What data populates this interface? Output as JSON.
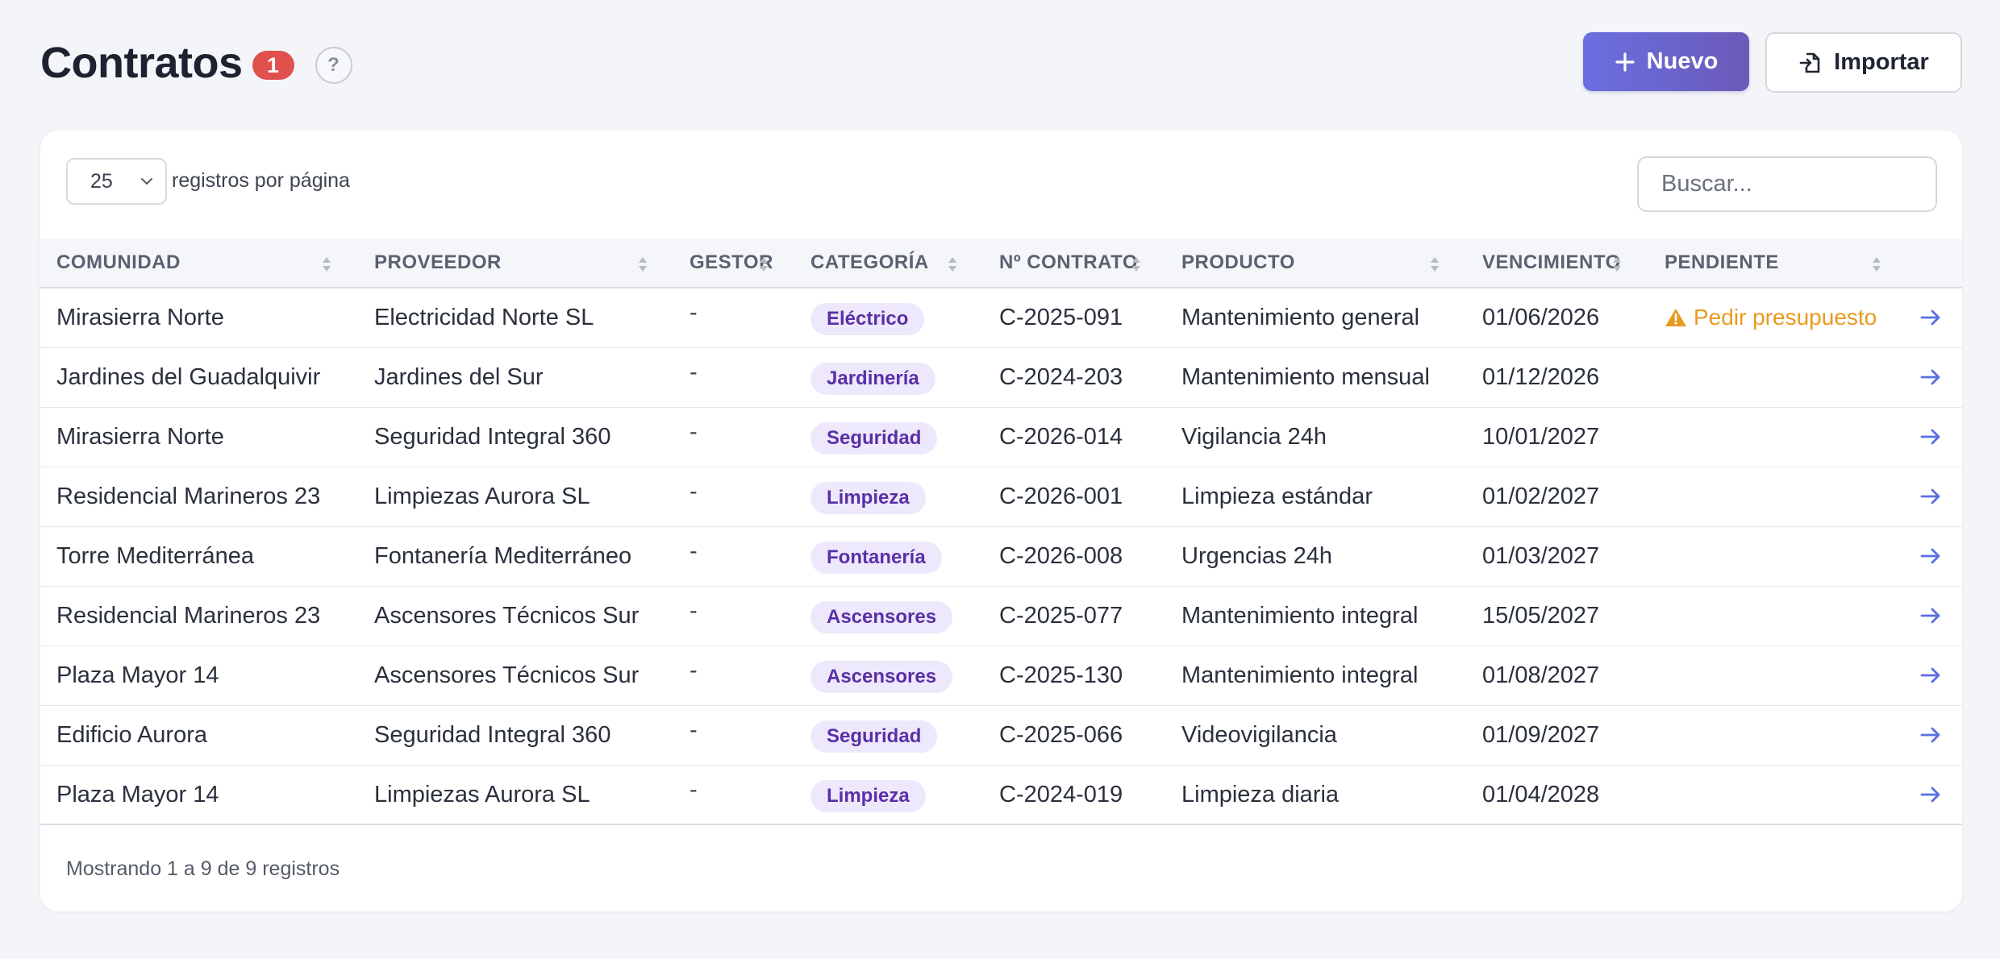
{
  "header": {
    "title": "Contratos",
    "badge_count": "1",
    "help_label": "?",
    "new_label": "Nuevo",
    "import_label": "Importar"
  },
  "controls": {
    "page_length": "25",
    "page_length_label": "registros por página",
    "search_placeholder": "Buscar..."
  },
  "columns": [
    "COMUNIDAD",
    "PROVEEDOR",
    "GESTOR",
    "CATEGORÍA",
    "Nº CONTRATO",
    "PRODUCTO",
    "VENCIMIENTO",
    "PENDIENTE"
  ],
  "rows": [
    {
      "comunidad": "Mirasierra Norte",
      "proveedor": "Electricidad Norte SL",
      "gestor": "-",
      "categoria": "Eléctrico",
      "contrato": "C-2025-091",
      "producto": "Mantenimiento general",
      "vencimiento": "01/06/2026",
      "pendiente": "Pedir presupuesto"
    },
    {
      "comunidad": "Jardines del Guadalquivir",
      "proveedor": "Jardines del Sur",
      "gestor": "-",
      "categoria": "Jardinería",
      "contrato": "C-2024-203",
      "producto": "Mantenimiento mensual",
      "vencimiento": "01/12/2026",
      "pendiente": ""
    },
    {
      "comunidad": "Mirasierra Norte",
      "proveedor": "Seguridad Integral 360",
      "gestor": "-",
      "categoria": "Seguridad",
      "contrato": "C-2026-014",
      "producto": "Vigilancia 24h",
      "vencimiento": "10/01/2027",
      "pendiente": ""
    },
    {
      "comunidad": "Residencial Marineros 23",
      "proveedor": "Limpiezas Aurora SL",
      "gestor": "-",
      "categoria": "Limpieza",
      "contrato": "C-2026-001",
      "producto": "Limpieza estándar",
      "vencimiento": "01/02/2027",
      "pendiente": ""
    },
    {
      "comunidad": "Torre Mediterránea",
      "proveedor": "Fontanería Mediterráneo",
      "gestor": "-",
      "categoria": "Fontanería",
      "contrato": "C-2026-008",
      "producto": "Urgencias 24h",
      "vencimiento": "01/03/2027",
      "pendiente": ""
    },
    {
      "comunidad": "Residencial Marineros 23",
      "proveedor": "Ascensores Técnicos Sur",
      "gestor": "-",
      "categoria": "Ascensores",
      "contrato": "C-2025-077",
      "producto": "Mantenimiento integral",
      "vencimiento": "15/05/2027",
      "pendiente": ""
    },
    {
      "comunidad": "Plaza Mayor 14",
      "proveedor": "Ascensores Técnicos Sur",
      "gestor": "-",
      "categoria": "Ascensores",
      "contrato": "C-2025-130",
      "producto": "Mantenimiento integral",
      "vencimiento": "01/08/2027",
      "pendiente": ""
    },
    {
      "comunidad": "Edificio Aurora",
      "proveedor": "Seguridad Integral 360",
      "gestor": "-",
      "categoria": "Seguridad",
      "contrato": "C-2025-066",
      "producto": "Videovigilancia",
      "vencimiento": "01/09/2027",
      "pendiente": ""
    },
    {
      "comunidad": "Plaza Mayor 14",
      "proveedor": "Limpiezas Aurora SL",
      "gestor": "-",
      "categoria": "Limpieza",
      "contrato": "C-2024-019",
      "producto": "Limpieza diaria",
      "vencimiento": "01/04/2028",
      "pendiente": ""
    }
  ],
  "footer": {
    "info": "Mostrando 1 a 9 de 9 registros"
  },
  "icons": {
    "new": "plus-icon",
    "import": "file-import-icon",
    "sort": "sort-icon",
    "warning": "warning-icon",
    "row_action": "arrow-right-icon"
  },
  "colors": {
    "accent": "#6a6fe0",
    "badge": "#e0504d",
    "tag_bg": "#ede8fb",
    "tag_text": "#5a2fa6",
    "warning": "#e89a1f"
  }
}
